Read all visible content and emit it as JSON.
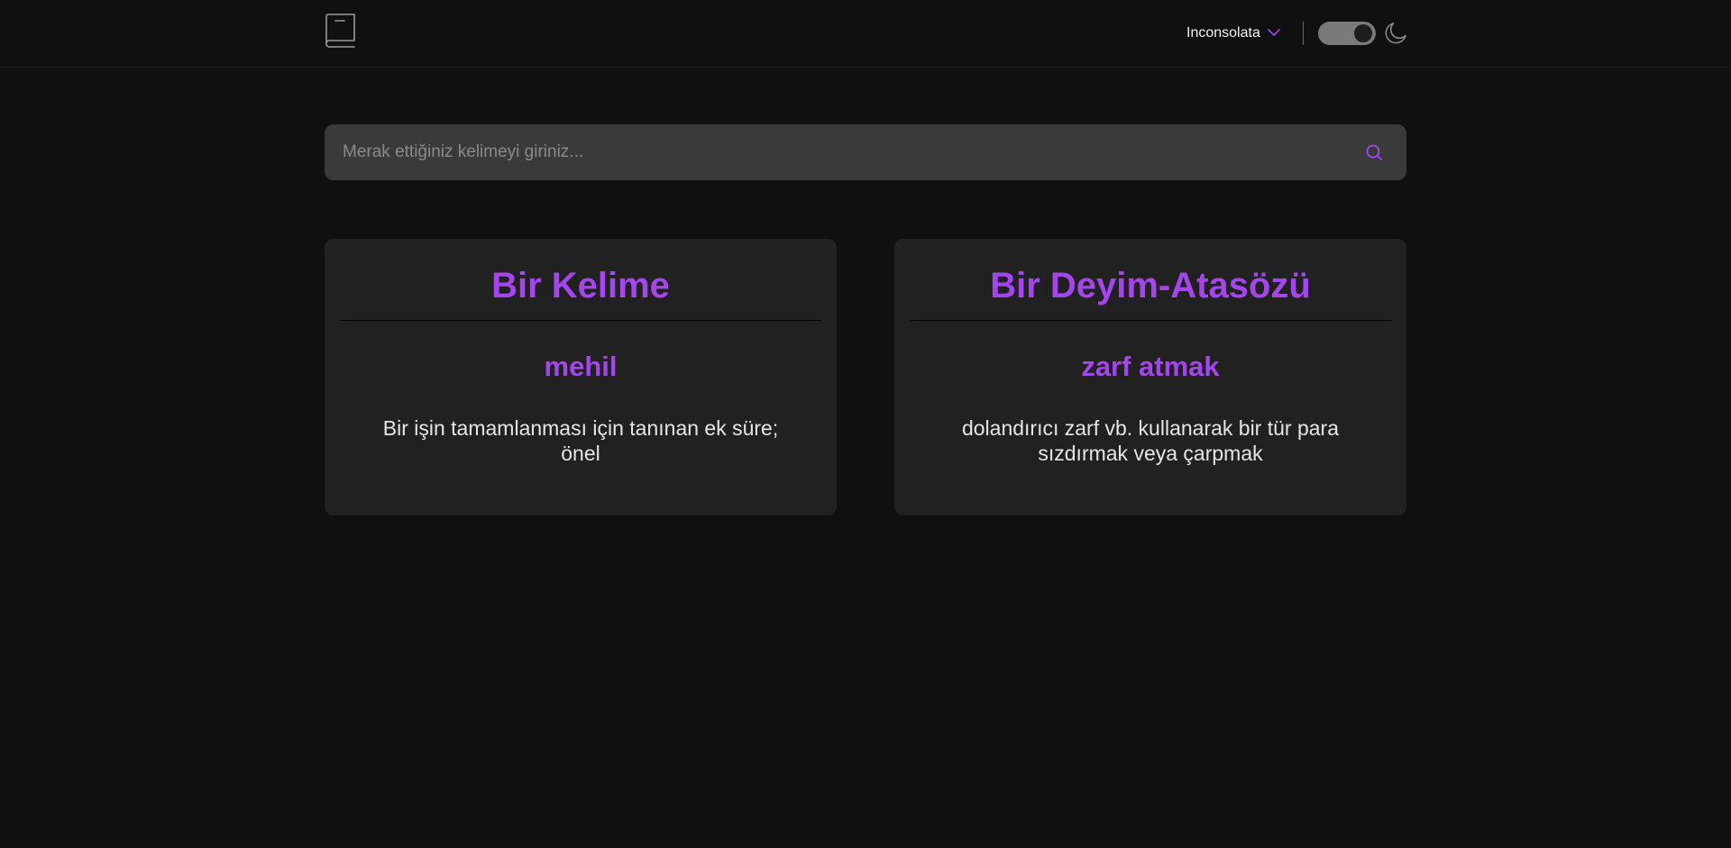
{
  "header": {
    "font_selector": {
      "selected": "Inconsolata"
    },
    "theme": {
      "dark_mode": true
    }
  },
  "search": {
    "placeholder": "Merak ettiğiniz kelimeyi giriniz...",
    "value": ""
  },
  "cards": [
    {
      "title": "Bir Kelime",
      "term": "mehil",
      "definition": "Bir işin tamamlanması için tanınan ek süre; önel"
    },
    {
      "title": "Bir Deyim-Atasözü",
      "term": "zarf atmak",
      "definition": "dolandırıcı zarf vb. kullanarak bir tür para sızdırmak veya çarpmak"
    }
  ],
  "colors": {
    "accent": "#a445ed",
    "background": "#101010",
    "card": "#212121",
    "search_bg": "#3a3a3a"
  },
  "icons": [
    "book-icon",
    "chevron-down-icon",
    "moon-icon",
    "search-icon"
  ]
}
